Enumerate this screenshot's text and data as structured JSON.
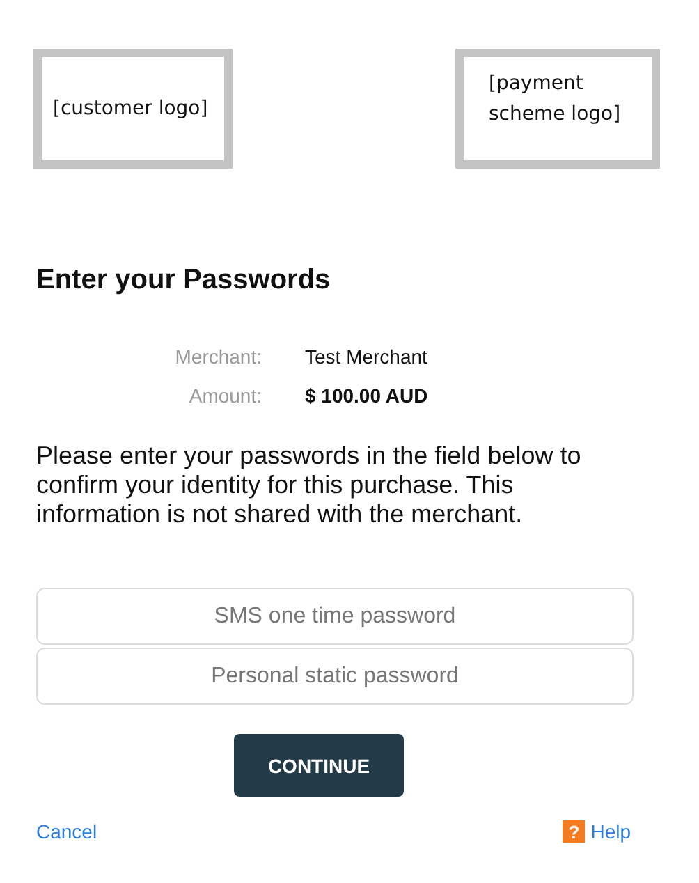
{
  "logos": [
    {
      "text": "[customer logo]"
    },
    {
      "text": "[payment scheme logo]"
    }
  ],
  "heading": "Enter your Passwords",
  "details": [
    {
      "label": "Merchant:",
      "value": "Test Merchant",
      "bold": false
    },
    {
      "label": "Amount:",
      "value": "$ 100.00 AUD",
      "bold": true
    }
  ],
  "instructions": "Please enter your passwords in the field below to confirm your identity for this purchase. This information is not shared with the merchant.",
  "fields": [
    {
      "placeholder": "SMS one time password"
    },
    {
      "placeholder": "Personal static password"
    }
  ],
  "continue_button": "CONTINUE",
  "cancel_link": "Cancel",
  "help": {
    "icon": "?",
    "label": "Help"
  }
}
